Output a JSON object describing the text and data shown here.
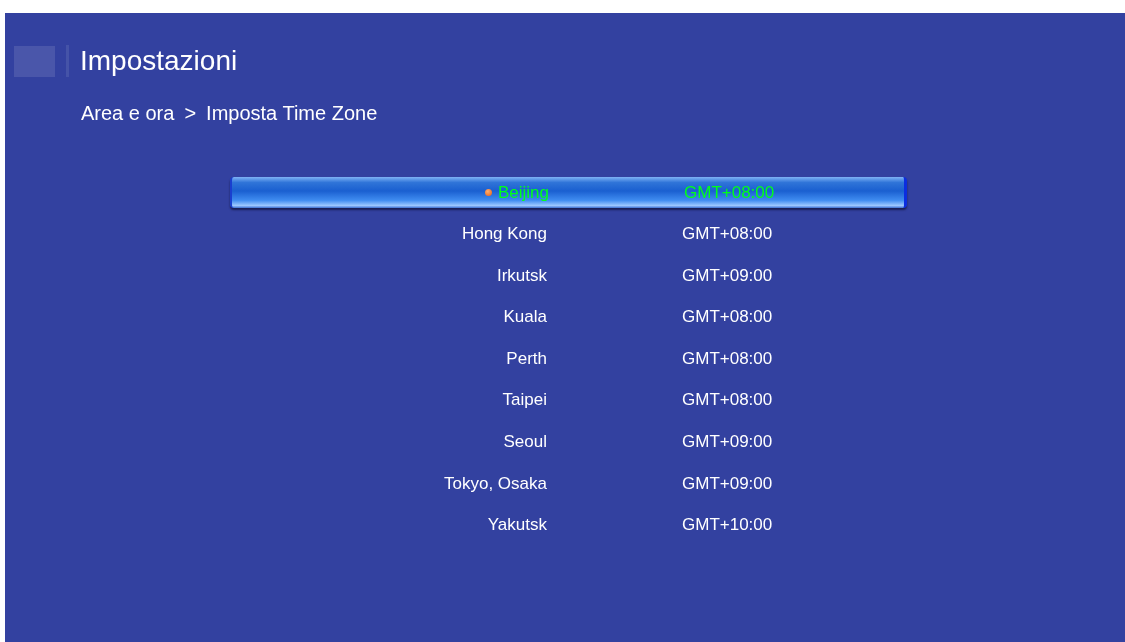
{
  "header": {
    "title": "Impostazioni"
  },
  "breadcrumb": {
    "parent": "Area e ora",
    "separator": ">",
    "current": "Imposta Time Zone"
  },
  "timezones": [
    {
      "city": "Beijing",
      "offset": "GMT+08:00",
      "selected": true
    },
    {
      "city": "Hong Kong",
      "offset": "GMT+08:00",
      "selected": false
    },
    {
      "city": "Irkutsk",
      "offset": "GMT+09:00",
      "selected": false
    },
    {
      "city": "Kuala",
      "offset": "GMT+08:00",
      "selected": false
    },
    {
      "city": "Perth",
      "offset": "GMT+08:00",
      "selected": false
    },
    {
      "city": "Taipei",
      "offset": "GMT+08:00",
      "selected": false
    },
    {
      "city": "Seoul",
      "offset": "GMT+09:00",
      "selected": false
    },
    {
      "city": "Tokyo, Osaka",
      "offset": "GMT+09:00",
      "selected": false
    },
    {
      "city": "Yakutsk",
      "offset": "GMT+10:00",
      "selected": false
    }
  ]
}
